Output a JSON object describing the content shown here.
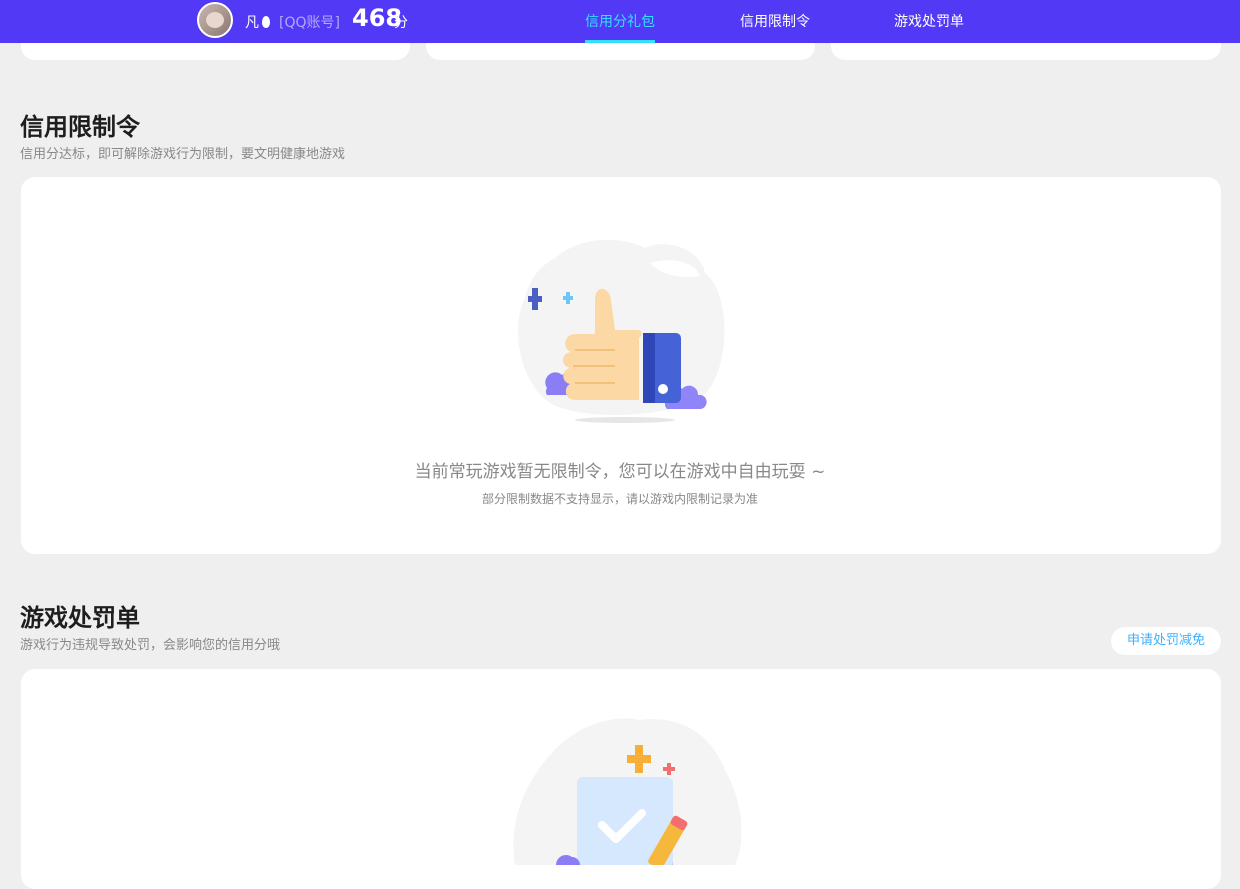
{
  "header": {
    "user_name": "凡",
    "account_tag": "[QQ账号]",
    "score": "468",
    "score_unit": "分",
    "tabs": [
      {
        "label": "信用分礼包",
        "active": true
      },
      {
        "label": "信用限制令",
        "active": false
      },
      {
        "label": "游戏处罚单",
        "active": false
      }
    ]
  },
  "restriction": {
    "title": "信用限制令",
    "subtitle": "信用分达标，即可解除游戏行为限制，要文明健康地游戏",
    "empty_text": "当前常玩游戏暂无限制令，您可以在游戏中自由玩耍 ~",
    "empty_note": "部分限制数据不支持显示，请以游戏内限制记录为准"
  },
  "penalty": {
    "title": "游戏处罚单",
    "subtitle": "游戏行为违规导致处罚，会影响您的信用分哦",
    "appeal_button": "申请处罚减免"
  },
  "colors": {
    "header_bg": "#5239f5",
    "active_tab": "#34e0ff",
    "page_bg": "#efefef",
    "link_blue": "#3db0ff"
  },
  "icons": [
    "avatar",
    "qq-icon",
    "thumbs-up-icon",
    "sparkle-icon",
    "cloud-icon",
    "checklist-icon",
    "pencil-icon"
  ]
}
